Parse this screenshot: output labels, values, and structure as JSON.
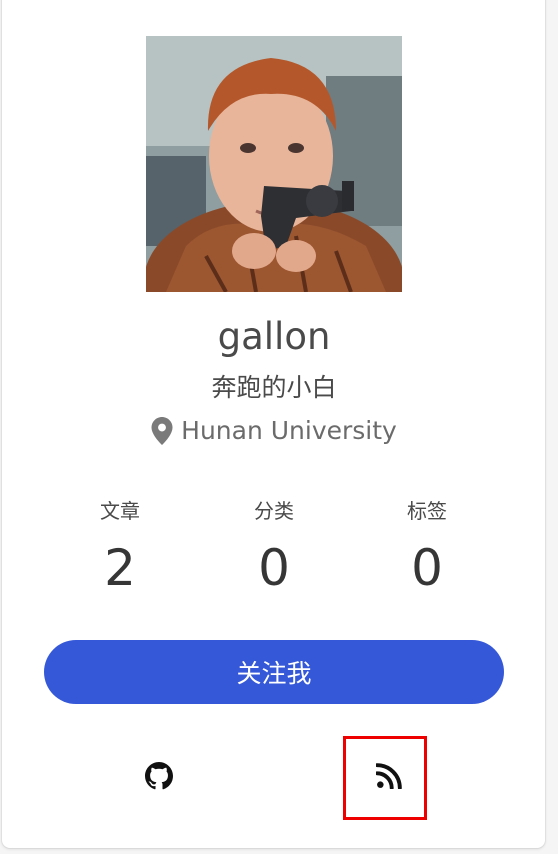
{
  "profile": {
    "name": "gallon",
    "subtitle": "奔跑的小白",
    "location": "Hunan University"
  },
  "stats": [
    {
      "label": "文章",
      "value": "2"
    },
    {
      "label": "分类",
      "value": "0"
    },
    {
      "label": "标签",
      "value": "0"
    }
  ],
  "follow_button": {
    "label": "关注我"
  },
  "social": [
    {
      "icon": "github-icon"
    },
    {
      "icon": "rss-icon"
    }
  ],
  "colors": {
    "accent": "#3558d8",
    "highlight": "#ee0000",
    "text": "#4a4a4a"
  }
}
